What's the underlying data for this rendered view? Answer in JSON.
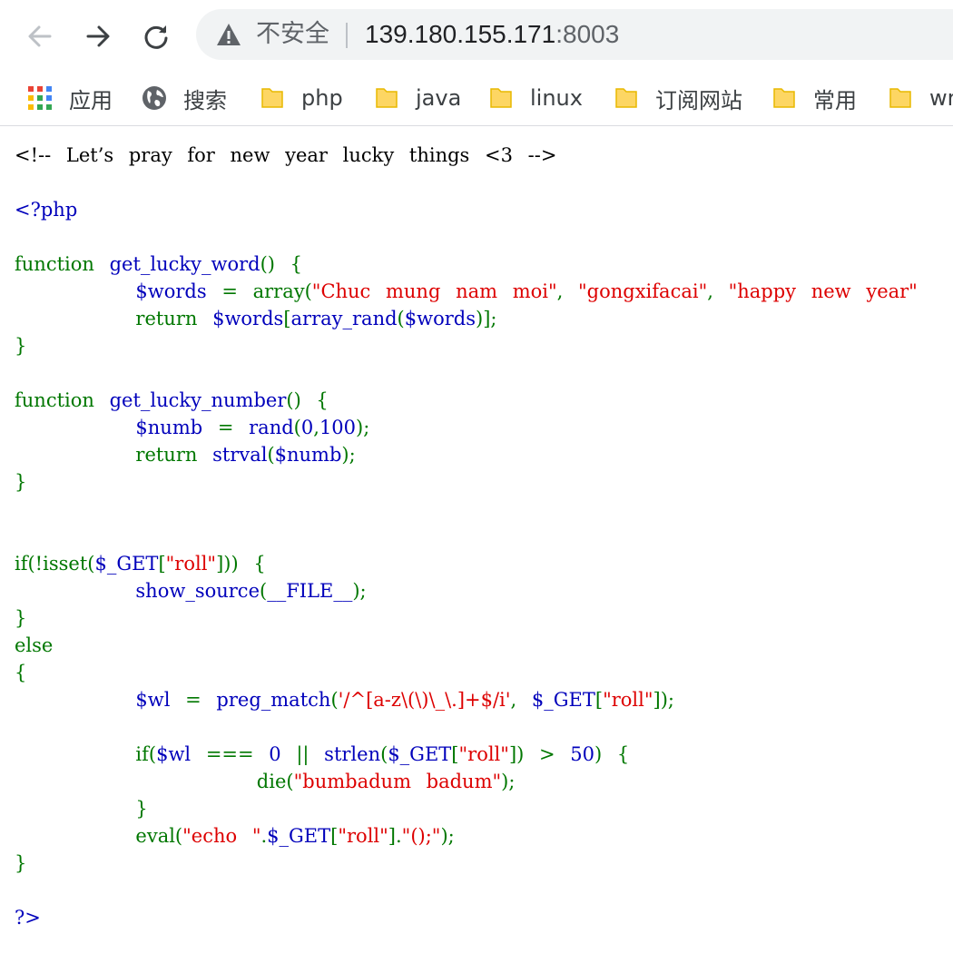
{
  "browser": {
    "security_label": "不安全",
    "url_host": "139.180.155.171",
    "url_port": ":8003",
    "icons": {
      "back": "arrow-left-icon",
      "forward": "arrow-right-icon",
      "reload": "reload-icon",
      "security": "warning-triangle-icon"
    }
  },
  "bookmarks": [
    {
      "label": "应用",
      "icon": "apps-grid-icon"
    },
    {
      "label": "搜索",
      "icon": "globe-icon"
    },
    {
      "label": "php",
      "icon": "folder-icon"
    },
    {
      "label": "java",
      "icon": "folder-icon"
    },
    {
      "label": "linux",
      "icon": "folder-icon"
    },
    {
      "label": "订阅网站",
      "icon": "folder-icon"
    },
    {
      "label": "常用",
      "icon": "folder-icon"
    },
    {
      "label": "wr",
      "icon": "folder-icon"
    }
  ],
  "colors": {
    "html": "#000000",
    "default": "#0000BB",
    "keyword": "#007700",
    "string": "#DD0000",
    "folder": "#FDD663"
  },
  "source": {
    "lines": [
      [
        {
          "t": "<!-- Let’s pray for new year lucky things <3 -->",
          "c": "html"
        }
      ],
      [],
      [
        {
          "t": "<?php",
          "c": "default"
        }
      ],
      [],
      [
        {
          "t": "function ",
          "c": "keyword"
        },
        {
          "t": "get_lucky_word",
          "c": "default"
        },
        {
          "t": "() {",
          "c": "keyword"
        }
      ],
      [
        {
          "t": "        ",
          "c": "keyword"
        },
        {
          "t": "$words ",
          "c": "default"
        },
        {
          "t": "= array(",
          "c": "keyword"
        },
        {
          "t": "\"Chuc mung nam moi\"",
          "c": "string"
        },
        {
          "t": ", ",
          "c": "keyword"
        },
        {
          "t": "\"gongxifacai\"",
          "c": "string"
        },
        {
          "t": ", ",
          "c": "keyword"
        },
        {
          "t": "\"happy new year\"",
          "c": "string"
        }
      ],
      [
        {
          "t": "        return ",
          "c": "keyword"
        },
        {
          "t": "$words",
          "c": "default"
        },
        {
          "t": "[",
          "c": "keyword"
        },
        {
          "t": "array_rand",
          "c": "default"
        },
        {
          "t": "(",
          "c": "keyword"
        },
        {
          "t": "$words",
          "c": "default"
        },
        {
          "t": ")];",
          "c": "keyword"
        }
      ],
      [
        {
          "t": "}",
          "c": "keyword"
        }
      ],
      [],
      [
        {
          "t": "function ",
          "c": "keyword"
        },
        {
          "t": "get_lucky_number",
          "c": "default"
        },
        {
          "t": "() {",
          "c": "keyword"
        }
      ],
      [
        {
          "t": "        ",
          "c": "keyword"
        },
        {
          "t": "$numb ",
          "c": "default"
        },
        {
          "t": "= ",
          "c": "keyword"
        },
        {
          "t": "rand",
          "c": "default"
        },
        {
          "t": "(",
          "c": "keyword"
        },
        {
          "t": "0",
          "c": "default"
        },
        {
          "t": ",",
          "c": "keyword"
        },
        {
          "t": "100",
          "c": "default"
        },
        {
          "t": ");",
          "c": "keyword"
        }
      ],
      [
        {
          "t": "        return ",
          "c": "keyword"
        },
        {
          "t": "strval",
          "c": "default"
        },
        {
          "t": "(",
          "c": "keyword"
        },
        {
          "t": "$numb",
          "c": "default"
        },
        {
          "t": ");",
          "c": "keyword"
        }
      ],
      [
        {
          "t": "}",
          "c": "keyword"
        }
      ],
      [],
      [],
      [
        {
          "t": "if(!isset(",
          "c": "keyword"
        },
        {
          "t": "$_GET",
          "c": "default"
        },
        {
          "t": "[",
          "c": "keyword"
        },
        {
          "t": "\"roll\"",
          "c": "string"
        },
        {
          "t": "])) {",
          "c": "keyword"
        }
      ],
      [
        {
          "t": "        ",
          "c": "keyword"
        },
        {
          "t": "show_source",
          "c": "default"
        },
        {
          "t": "(",
          "c": "keyword"
        },
        {
          "t": "__FILE__",
          "c": "default"
        },
        {
          "t": ");",
          "c": "keyword"
        }
      ],
      [
        {
          "t": "}",
          "c": "keyword"
        }
      ],
      [
        {
          "t": "else",
          "c": "keyword"
        }
      ],
      [
        {
          "t": "{",
          "c": "keyword"
        }
      ],
      [
        {
          "t": "        ",
          "c": "keyword"
        },
        {
          "t": "$wl ",
          "c": "default"
        },
        {
          "t": "= ",
          "c": "keyword"
        },
        {
          "t": "preg_match",
          "c": "default"
        },
        {
          "t": "(",
          "c": "keyword"
        },
        {
          "t": "'/^[a-z\\(\\)\\_\\.]+$/i'",
          "c": "string"
        },
        {
          "t": ", ",
          "c": "keyword"
        },
        {
          "t": "$_GET",
          "c": "default"
        },
        {
          "t": "[",
          "c": "keyword"
        },
        {
          "t": "\"roll\"",
          "c": "string"
        },
        {
          "t": "]);",
          "c": "keyword"
        }
      ],
      [],
      [
        {
          "t": "        if(",
          "c": "keyword"
        },
        {
          "t": "$wl ",
          "c": "default"
        },
        {
          "t": "=== ",
          "c": "keyword"
        },
        {
          "t": "0 ",
          "c": "default"
        },
        {
          "t": "|| ",
          "c": "keyword"
        },
        {
          "t": "strlen",
          "c": "default"
        },
        {
          "t": "(",
          "c": "keyword"
        },
        {
          "t": "$_GET",
          "c": "default"
        },
        {
          "t": "[",
          "c": "keyword"
        },
        {
          "t": "\"roll\"",
          "c": "string"
        },
        {
          "t": "]) > ",
          "c": "keyword"
        },
        {
          "t": "50",
          "c": "default"
        },
        {
          "t": ") {",
          "c": "keyword"
        }
      ],
      [
        {
          "t": "                die(",
          "c": "keyword"
        },
        {
          "t": "\"bumbadum badum\"",
          "c": "string"
        },
        {
          "t": ");",
          "c": "keyword"
        }
      ],
      [
        {
          "t": "        }",
          "c": "keyword"
        }
      ],
      [
        {
          "t": "        eval(",
          "c": "keyword"
        },
        {
          "t": "\"echo \"",
          "c": "string"
        },
        {
          "t": ".",
          "c": "keyword"
        },
        {
          "t": "$_GET",
          "c": "default"
        },
        {
          "t": "[",
          "c": "keyword"
        },
        {
          "t": "\"roll\"",
          "c": "string"
        },
        {
          "t": "].",
          "c": "keyword"
        },
        {
          "t": "\"();\"",
          "c": "string"
        },
        {
          "t": ");",
          "c": "keyword"
        }
      ],
      [
        {
          "t": "}",
          "c": "keyword"
        }
      ],
      [],
      [
        {
          "t": "?>",
          "c": "default"
        }
      ]
    ]
  }
}
